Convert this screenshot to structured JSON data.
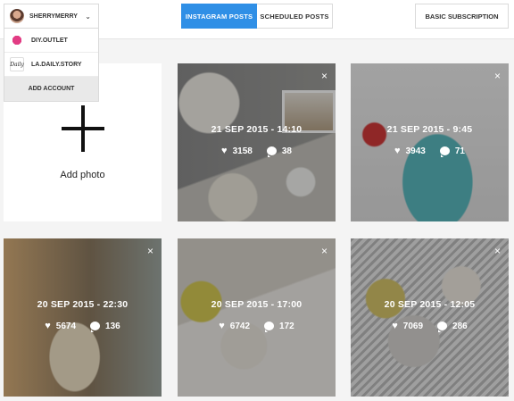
{
  "account": {
    "current": "SHERRYMERRY",
    "others": [
      "DIY.OUTLET",
      "LA.DAILY.STORY"
    ],
    "add_account": "ADD ACCOUNT",
    "daily_logo_text": "Daily"
  },
  "tabs": {
    "instagram": "INSTAGRAM POSTS",
    "scheduled": "SCHEDULED POSTS"
  },
  "subscription": "BASIC SUBSCRIPTION",
  "add_photo": "Add photo",
  "colors": {
    "accent": "#2f8fe6"
  },
  "icons": {
    "close": "×",
    "heart": "♥"
  },
  "posts": [
    {
      "date": "21 SEP 2015 - 14:10",
      "likes": "3158",
      "comments": "38"
    },
    {
      "date": "21 SEP 2015 - 9:45",
      "likes": "3943",
      "comments": "71"
    },
    {
      "date": "20 SEP 2015 - 22:30",
      "likes": "5674",
      "comments": "136"
    },
    {
      "date": "20 SEP 2015 - 17:00",
      "likes": "6742",
      "comments": "172"
    },
    {
      "date": "20 SEP 2015 - 12:05",
      "likes": "7069",
      "comments": "286"
    }
  ]
}
